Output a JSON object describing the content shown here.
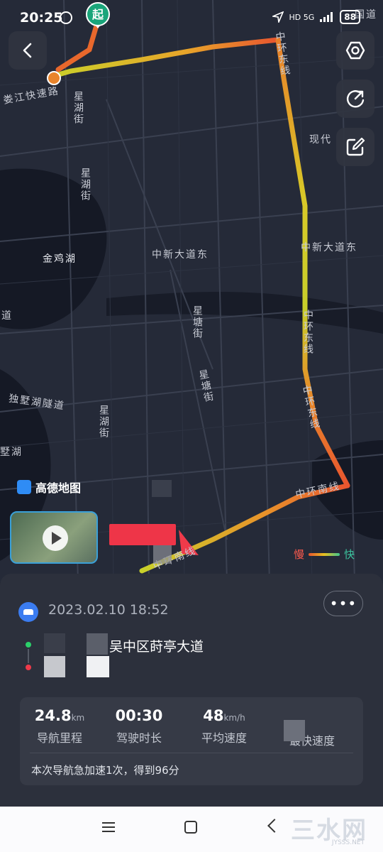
{
  "status_bar": {
    "time": "20:25",
    "network": "HD 5G",
    "battery": "88"
  },
  "map": {
    "start_marker": "起",
    "brand": "高德地图",
    "legend_slow": "慢",
    "legend_fast": "快",
    "labels": [
      {
        "text": "娄江快速路",
        "name": "label-loujiang"
      },
      {
        "text": "星湖街",
        "name": "label-xinghu-1"
      },
      {
        "text": "星湖街",
        "name": "label-xinghu-2"
      },
      {
        "text": "星湖街",
        "name": "label-xinghu-3"
      },
      {
        "text": "金鸡湖",
        "name": "label-jinjihu"
      },
      {
        "text": "中新大道东",
        "name": "label-zhongxin-1"
      },
      {
        "text": "中新大道东",
        "name": "label-zhongxin-2"
      },
      {
        "text": "星塘街",
        "name": "label-xingtang-1"
      },
      {
        "text": "星塘街",
        "name": "label-xingtang-2"
      },
      {
        "text": "独墅湖隧道",
        "name": "label-dushu"
      },
      {
        "text": "中环东线",
        "name": "label-zhonghuan-1"
      },
      {
        "text": "中环东线",
        "name": "label-zhonghuan-2"
      },
      {
        "text": "中环东线",
        "name": "label-zhonghuan-3"
      },
      {
        "text": "中环南线",
        "name": "label-zhonghuan-south-1"
      },
      {
        "text": "中环南线",
        "name": "label-zhonghuan-south-2"
      },
      {
        "text": "现代",
        "name": "label-xiandai"
      },
      {
        "text": "道",
        "name": "label-dao"
      },
      {
        "text": "墅湖",
        "name": "label-shuhu"
      },
      {
        "text": "国道",
        "name": "label-guodao"
      }
    ],
    "icons": {
      "back": "chevron-left-icon",
      "settings": "hexagon-settings-icon",
      "share": "share-icon",
      "edit": "edit-icon"
    }
  },
  "trip": {
    "date": "2023.02.10 18:52",
    "more": "•••",
    "end_address": "吴中区莳亭大道",
    "stats": [
      {
        "value": "24.8",
        "unit": "km",
        "label": "导航里程"
      },
      {
        "value": "00:30",
        "unit": "",
        "label": "驾驶时长"
      },
      {
        "value": "48",
        "unit": "km/h",
        "label": "平均速度"
      },
      {
        "value": "",
        "unit": "",
        "label": "最快速度"
      }
    ],
    "note": "本次导航急加速1次，得到96分"
  },
  "watermark": {
    "text": "三水网",
    "sub": "JYSSS.NET"
  },
  "colors": {
    "route_slow": "#e8552f",
    "route_mid": "#e7c020",
    "route_fast": "#b7d02c",
    "start_marker": "#1aa57a"
  }
}
